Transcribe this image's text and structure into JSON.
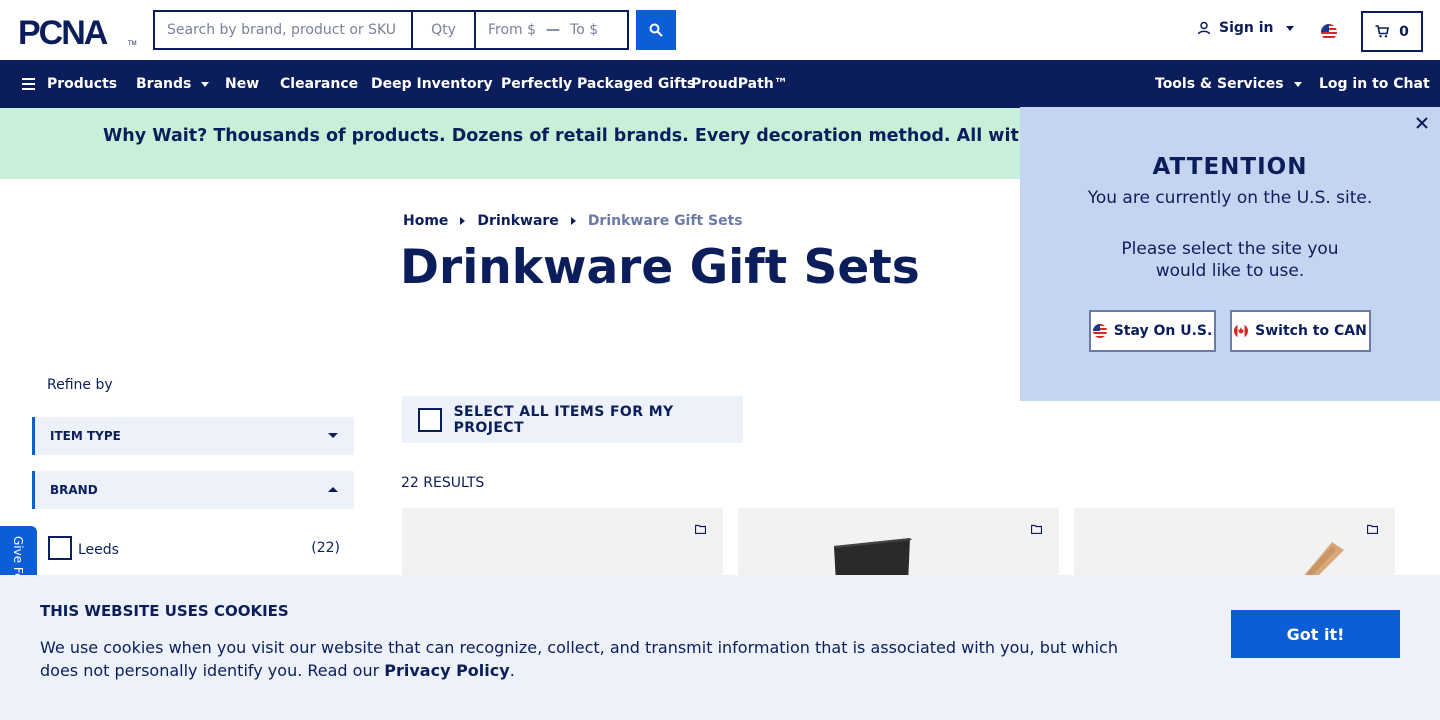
{
  "header": {
    "logo_text": "PCNA",
    "search_placeholder": "Search by brand, product or SKU",
    "qty_placeholder": "Qty",
    "from_placeholder": "From $",
    "price_dash": "—",
    "to_placeholder": "To $",
    "sign_in_label": "Sign in",
    "cart_count": "0"
  },
  "nav": {
    "items": [
      {
        "label": "Products"
      },
      {
        "label": "Brands"
      },
      {
        "label": "New"
      },
      {
        "label": "Clearance"
      },
      {
        "label": "Deep Inventory"
      },
      {
        "label": "Perfectly Packaged Gifts"
      },
      {
        "label": "ProudPath™"
      },
      {
        "label": "Tools & Services"
      },
      {
        "label": "Log in to Chat"
      }
    ]
  },
  "promo": {
    "text": "Why Wait? Thousands of products. Dozens of retail brands. Every decoration method. All with a standard"
  },
  "breadcrumb": {
    "items": [
      "Home",
      "Drinkware",
      "Drinkware Gift Sets"
    ]
  },
  "page_title": "Drinkware Gift Sets",
  "sidebar": {
    "refine_label": "Refine by",
    "filters": [
      {
        "label": "ITEM TYPE",
        "expanded": false
      },
      {
        "label": "BRAND",
        "expanded": true
      }
    ],
    "brand_options": [
      {
        "label": "Leeds",
        "count": "(22)"
      }
    ],
    "feedback_label": "Give Feedback"
  },
  "results": {
    "select_all_label": "SELECT ALL ITEMS FOR MY PROJECT",
    "count_label": "22 RESULTS"
  },
  "attention": {
    "title": "ATTENTION",
    "line1": "You are currently on the U.S. site.",
    "line2": "Please select the site you would like to use.",
    "stay_label": "Stay On U.S.",
    "switch_label": "Switch to CAN"
  },
  "cookie": {
    "title": "THIS WEBSITE USES COOKIES",
    "text": "We use cookies when you visit our website that can recognize, collect, and transmit information that is associated with you, but which does not personally identify you. Read our",
    "link_label": "Privacy Policy",
    "period": ".",
    "button_label": "Got it!"
  },
  "colors": {
    "navy": "#0b1e5b",
    "accent_blue": "#0b5ed7",
    "promo_green": "#c8f0d8",
    "popup_blue": "#c5d4f0",
    "light_panel": "#edf1fa"
  }
}
